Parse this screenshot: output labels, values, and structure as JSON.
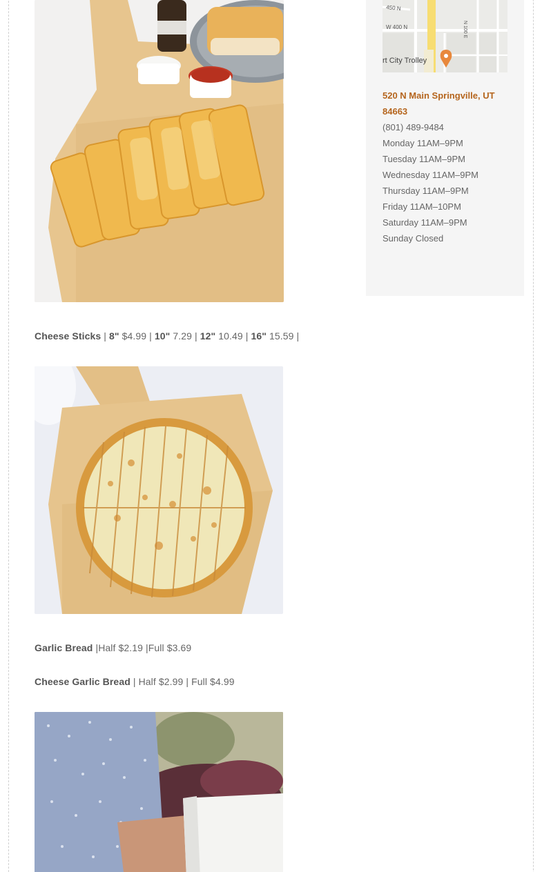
{
  "menu": {
    "cheese_sticks": {
      "name": "Cheese Sticks",
      "sep1": " | ",
      "s8_label": "8\"",
      "s8_price": " $4.99 | ",
      "s10_label": "10\"",
      "s10_price": " 7.29 | ",
      "s12_label": "12\"",
      "s12_price": " 10.49 | ",
      "s16_label": "16\"",
      "s16_price": " 15.59 |"
    },
    "garlic_bread": {
      "name": "Garlic Bread",
      "details": " |Half $2.19 |Full $3.69"
    },
    "cheese_garlic_bread": {
      "name": "Cheese Garlic Bread",
      "details": " | Half $2.99 | Full $4.99"
    }
  },
  "map": {
    "street_450n": "450 N",
    "street_w400n": "W 400 N",
    "street_n100e": "N 100 E",
    "place": "rt City Trolley"
  },
  "sidebar": {
    "address": "520 N Main Springville, UT 84663",
    "phone": "(801) 489-9484",
    "hours": [
      "Monday 11AM–9PM",
      "Tuesday 11AM–9PM",
      "Wednesday 11AM–9PM",
      "Thursday 11AM–9PM",
      "Friday 11AM–10PM",
      "Saturday 11AM–9PM",
      "Sunday Closed"
    ]
  },
  "colors": {
    "accent": "#b5651d",
    "sidebar_bg": "#f5f5f5",
    "text": "#666666"
  }
}
